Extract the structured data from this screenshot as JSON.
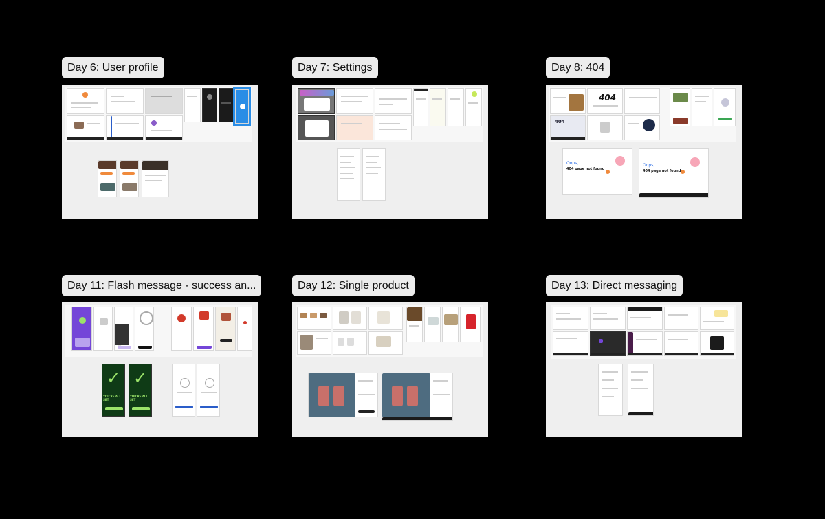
{
  "canvas": {
    "background": "#000000"
  },
  "frames": [
    {
      "label": "Day 6: User profile"
    },
    {
      "label": "Day 7: Settings"
    },
    {
      "label": "Day 8: 404"
    },
    {
      "label": "Day 11: Flash message - success an..."
    },
    {
      "label": "Day 12: Single product"
    },
    {
      "label": "Day 13: Direct messaging"
    }
  ],
  "thumbnails": {
    "day8_text_a": "404",
    "day8_oops": "Oops,",
    "day8_not_found": "404 page not found",
    "day11_all_set_a": "YOU'RE ALL SET",
    "day11_all_set_b": "YOU'RE ALL SET"
  },
  "colors": {
    "frame_bg": "#efefef",
    "label_bg": "#ececec",
    "selection": "#2a8de6",
    "success_green": "#9be36a",
    "peach": "#f7a6b7",
    "orange": "#f08a3c",
    "bottle": "#c8706a",
    "slate": "#4e6c80"
  }
}
